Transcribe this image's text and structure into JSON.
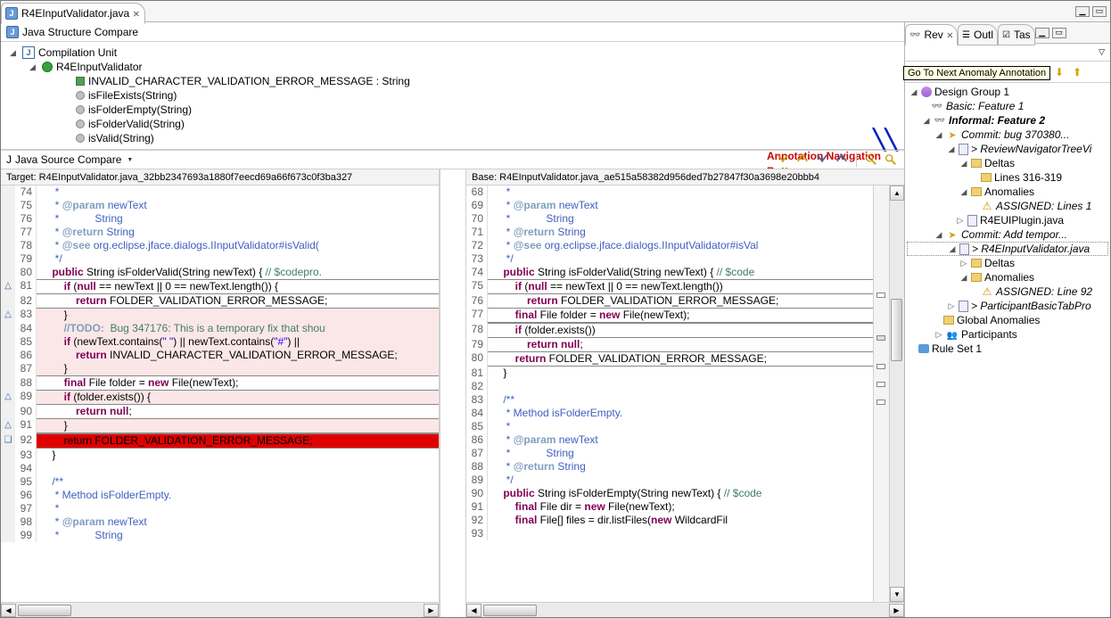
{
  "tab": {
    "title": "R4EInputValidator.java",
    "active": true
  },
  "structureCompare": {
    "title": "Java Structure Compare",
    "root": "Compilation Unit",
    "class": "R4EInputValidator",
    "field": "INVALID_CHARACTER_VALIDATION_ERROR_MESSAGE : String",
    "methods": [
      "isFileExists(String)",
      "isFolderEmpty(String)",
      "isFolderValid(String)",
      "isValid(String)"
    ]
  },
  "annotation_note": {
    "l1": "Annotation Navigation",
    "l2": "Buttons"
  },
  "sourceCompare": {
    "title": "Java Source Compare"
  },
  "tooltip": "Go To Next Anomaly Annotation",
  "target": {
    "header": "Target: R4EInputValidator.java_32bb2347693a1880f7eecd69a66f673c0f3ba327",
    "lines": [
      {
        "n": 74,
        "m": "",
        "c": "",
        "pre": "     ",
        "t": "*"
      },
      {
        "n": 75,
        "m": "",
        "c": "",
        "pre": "     ",
        "t": "* <jdt>@param</jdt> newText"
      },
      {
        "n": 76,
        "m": "",
        "c": "",
        "pre": "     ",
        "t": "*            String"
      },
      {
        "n": 77,
        "m": "",
        "c": "",
        "pre": "     ",
        "t": "* <jdt>@return</jdt> String"
      },
      {
        "n": 78,
        "m": "",
        "c": "",
        "pre": "     ",
        "t": "* <jdt>@see</jdt> org.eclipse.jface.dialogs.IInputValidator#isValid("
      },
      {
        "n": 79,
        "m": "",
        "c": "",
        "pre": "     ",
        "t": "*/"
      },
      {
        "n": 80,
        "m": "",
        "c": "",
        "pre": "    ",
        "raw": "<span class='kw'>public</span> String isFolderValid(String newText) { <span class='cm'>// $codepro.</span>"
      },
      {
        "n": 81,
        "m": "△",
        "c": "boxed",
        "pre": "        ",
        "raw": "<span class='kw'>if</span> (<span class='kw'>null</span> == newText || 0 == newText.length()) {"
      },
      {
        "n": 82,
        "m": "",
        "c": "",
        "pre": "            ",
        "raw": "<span class='kw'>return</span> FOLDER_VALIDATION_ERROR_MESSAGE;"
      },
      {
        "n": 83,
        "m": "△",
        "c": "chg boxed-top",
        "pre": "        ",
        "raw": "}"
      },
      {
        "n": 84,
        "m": "",
        "c": "chg",
        "pre": "        ",
        "raw": "<span class='todo'>//TODO:</span><span class='cm'>  Bug 347176: This is a temporary fix that shou</span>"
      },
      {
        "n": 85,
        "m": "",
        "c": "chg",
        "pre": "        ",
        "raw": "<span class='kw'>if</span> (newText.contains(<span class='str'>\" \"</span>) || newText.contains(<span class='str'>\"#\"</span>) ||"
      },
      {
        "n": 86,
        "m": "",
        "c": "chg",
        "pre": "            ",
        "raw": "<span class='kw'>return</span> INVALID_CHARACTER_VALIDATION_ERROR_MESSAGE;"
      },
      {
        "n": 87,
        "m": "",
        "c": "chg boxed-bot",
        "pre": "        ",
        "raw": "}"
      },
      {
        "n": 88,
        "m": "",
        "c": "",
        "pre": "        ",
        "raw": "<span class='kw'>final</span> File folder = <span class='kw'>new</span> File(newText);"
      },
      {
        "n": 89,
        "m": "△",
        "c": "chg boxed",
        "pre": "        ",
        "raw": "<span class='kw'>if</span> (folder.exists()) {"
      },
      {
        "n": 90,
        "m": "",
        "c": "",
        "pre": "            ",
        "raw": "<span class='kw'>return null</span>;"
      },
      {
        "n": 91,
        "m": "△",
        "c": "chg boxed",
        "pre": "        ",
        "raw": "}"
      },
      {
        "n": 92,
        "m": "❏",
        "c": "err boxed",
        "pre": "        ",
        "raw": "return FOLDER_VALIDATION_ERROR_MESSAGE;"
      },
      {
        "n": 93,
        "m": "",
        "c": "",
        "pre": "    ",
        "raw": "}"
      },
      {
        "n": 94,
        "m": "",
        "c": "",
        "pre": "",
        "raw": ""
      },
      {
        "n": 95,
        "m": "",
        "c": "",
        "pre": "    ",
        "t": "/**"
      },
      {
        "n": 96,
        "m": "",
        "c": "",
        "pre": "     ",
        "t": "* Method isFolderEmpty."
      },
      {
        "n": 97,
        "m": "",
        "c": "",
        "pre": "     ",
        "t": "*"
      },
      {
        "n": 98,
        "m": "",
        "c": "",
        "pre": "     ",
        "t": "* <jdt>@param</jdt> newText"
      },
      {
        "n": 99,
        "m": "",
        "c": "",
        "pre": "     ",
        "t": "*            String"
      }
    ]
  },
  "base": {
    "header": "Base: R4EInputValidator.java_ae515a58382d956ded7b27847f30a3698e20bbb4",
    "lines": [
      {
        "n": 68,
        "pre": "     ",
        "t": "*"
      },
      {
        "n": 69,
        "pre": "     ",
        "t": "* <jdt>@param</jdt> newText"
      },
      {
        "n": 70,
        "pre": "     ",
        "t": "*            String"
      },
      {
        "n": 71,
        "pre": "     ",
        "t": "* <jdt>@return</jdt> String"
      },
      {
        "n": 72,
        "pre": "     ",
        "t": "* <jdt>@see</jdt> org.eclipse.jface.dialogs.IInputValidator#isVal"
      },
      {
        "n": 73,
        "pre": "     ",
        "t": "*/"
      },
      {
        "n": 74,
        "pre": "    ",
        "raw": "<span class='kw'>public</span> String isFolderValid(String newText) { <span class='cm'>// $code</span>"
      },
      {
        "n": 75,
        "c": "boxed",
        "pre": "        ",
        "raw": "<span class='kw'>if</span> (<span class='kw'>null</span> == newText || 0 == newText.length())"
      },
      {
        "n": 76,
        "pre": "            ",
        "raw": "<span class='kw'>return</span> FOLDER_VALIDATION_ERROR_MESSAGE;"
      },
      {
        "n": 77,
        "c": "boxed",
        "pre": "        ",
        "raw": "<span class='kw'>final</span> File folder = <span class='kw'>new</span> File(newText);"
      },
      {
        "n": 78,
        "c": "boxed",
        "pre": "        ",
        "raw": "<span class='kw'>if</span> (folder.exists())"
      },
      {
        "n": 79,
        "pre": "            ",
        "raw": "<span class='kw'>return null</span>;"
      },
      {
        "n": 80,
        "c": "boxed",
        "pre": "        ",
        "raw": "<span class='kw'>return</span> FOLDER_VALIDATION_ERROR_MESSAGE;"
      },
      {
        "n": 81,
        "pre": "    ",
        "raw": "}"
      },
      {
        "n": 82,
        "pre": "",
        "raw": ""
      },
      {
        "n": 83,
        "pre": "    ",
        "t": "/**"
      },
      {
        "n": 84,
        "pre": "     ",
        "t": "* Method isFolderEmpty."
      },
      {
        "n": 85,
        "pre": "     ",
        "t": "*"
      },
      {
        "n": 86,
        "pre": "     ",
        "t": "* <jdt>@param</jdt> newText"
      },
      {
        "n": 87,
        "pre": "     ",
        "t": "*            String"
      },
      {
        "n": 88,
        "pre": "     ",
        "t": "* <jdt>@return</jdt> String"
      },
      {
        "n": 89,
        "pre": "     ",
        "t": "*/"
      },
      {
        "n": 90,
        "pre": "    ",
        "raw": "<span class='kw'>public</span> String isFolderEmpty(String newText) { <span class='cm'>// $code</span>"
      },
      {
        "n": 91,
        "pre": "        ",
        "raw": "<span class='kw'>final</span> File dir = <span class='kw'>new</span> File(newText);"
      },
      {
        "n": 92,
        "pre": "        ",
        "raw": "<span class='kw'>final</span> File[] files = dir.listFiles(<span class='kw'>new</span> WildcardFil"
      },
      {
        "n": 93,
        "pre": "",
        "raw": ""
      }
    ]
  },
  "rightTabs": {
    "rev": "Rev",
    "outl": "Outl",
    "tas": "Tas"
  },
  "tree": {
    "group": "Design Group 1",
    "basic": "Basic: Feature 1",
    "informal": "Informal: Feature 2",
    "commit1": "Commit: bug 370380...",
    "file1": "> ReviewNavigatorTreeVi",
    "deltas": "Deltas",
    "deltas_line": "Lines 316-319",
    "anomalies": "Anomalies",
    "anom1": "ASSIGNED: Lines 1",
    "file2": "R4EUIPlugin.java",
    "commit2": "Commit: Add tempor...",
    "file3": "> R4EInputValidator.java",
    "anom2": "ASSIGNED: Line 92",
    "file4": "> ParticipantBasicTabPro",
    "global": "Global Anomalies",
    "participants": "Participants",
    "ruleset": "Rule Set 1"
  }
}
